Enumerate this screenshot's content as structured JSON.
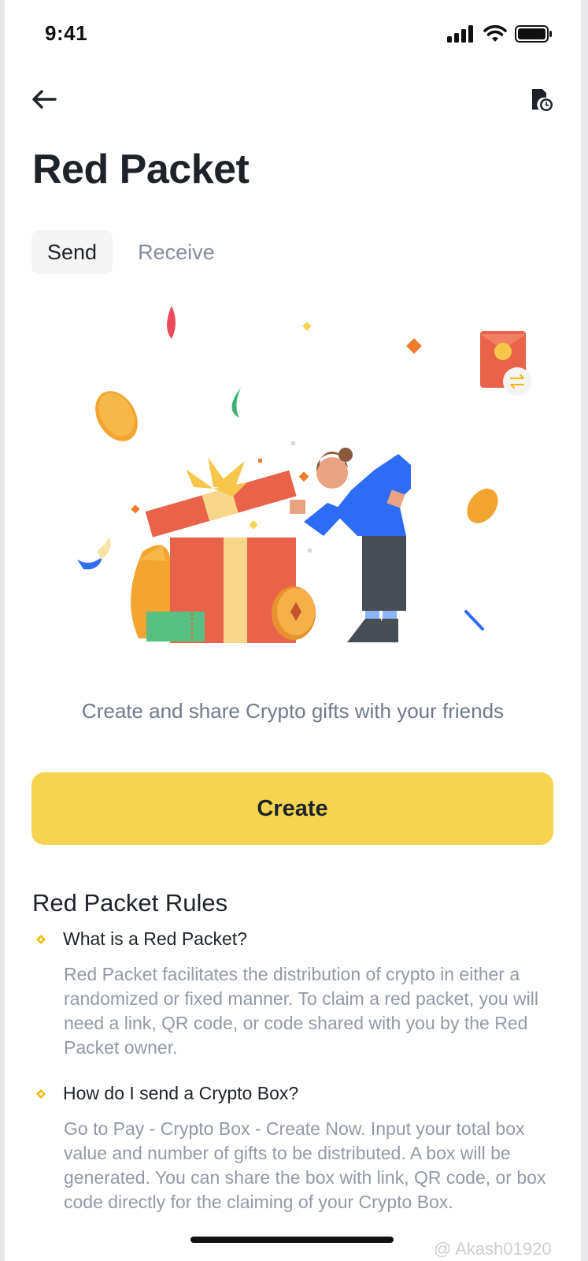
{
  "status_bar": {
    "time": "9:41"
  },
  "page": {
    "title": "Red Packet"
  },
  "tabs": [
    {
      "label": "Send",
      "active": true
    },
    {
      "label": "Receive",
      "active": false
    }
  ],
  "hero": {
    "subtitle": "Create and share Crypto gifts with your friends"
  },
  "actions": {
    "create_label": "Create"
  },
  "rules": {
    "title": "Red Packet Rules",
    "items": [
      {
        "question": "What is a Red Packet?",
        "answer": "Red Packet facilitates the distribution of crypto in either a randomized or fixed manner. To claim a red packet, you will need a link, QR code, or code shared with you by the Red Packet owner."
      },
      {
        "question": "How do I send a Crypto Box?",
        "answer": "Go to Pay - Crypto Box - Create Now. Input your total box value and number of gifts to be distributed. A box will be generated. You can share the box with link, QR code, or box code directly for the claiming of your Crypto Box."
      }
    ]
  },
  "watermark": "@ Akash01920",
  "colors": {
    "accent": "#f6d451",
    "text_primary": "#1e2329",
    "text_secondary": "#929aa5",
    "bullet": "#f0b90b"
  },
  "icons": [
    "back-arrow-icon",
    "history-icon",
    "signal-icon",
    "wifi-icon",
    "battery-icon",
    "diamond-bullet-icon"
  ]
}
